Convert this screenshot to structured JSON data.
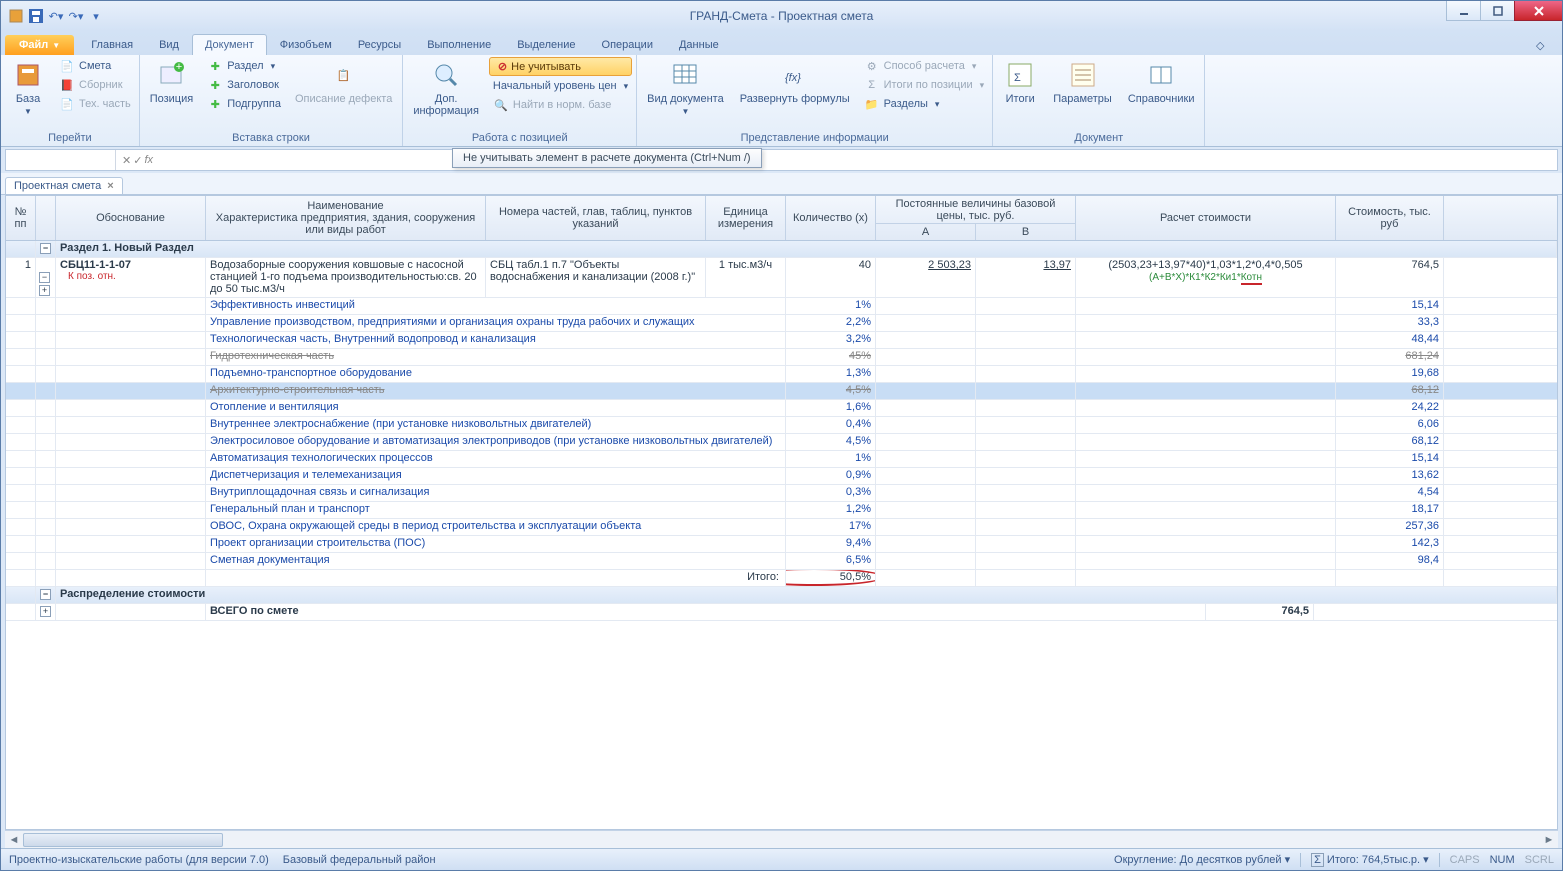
{
  "title": "ГРАНД-Смета - Проектная смета",
  "tabs": {
    "file": "Файл",
    "list": [
      "Главная",
      "Вид",
      "Документ",
      "Физобъем",
      "Ресурсы",
      "Выполнение",
      "Выделение",
      "Операции",
      "Данные"
    ],
    "active": "Документ"
  },
  "ribbon": {
    "group1": {
      "label": "Перейти",
      "base": "База",
      "smeta": "Смета",
      "sbornik": "Сборник",
      "techpart": "Тех. часть"
    },
    "group2": {
      "label": "Вставка строки",
      "position": "Позиция",
      "razdel": "Раздел",
      "zagolovok": "Заголовок",
      "podgruppa": "Подгруппа",
      "desc": "Описание дефекта"
    },
    "group3": {
      "label": "Работа с позицией",
      "dopinfo": "Доп.\nинформация",
      "neuch": "Не учитывать",
      "startlvl": "Начальный уровень цен",
      "findnorm": "Найти в норм. базе"
    },
    "group4": {
      "label": "Представление информации",
      "viddoc": "Вид документа",
      "razvern": "Развернуть формулы",
      "sposob": "Способ расчета",
      "itogipos": "Итоги по позиции",
      "razdely": "Разделы"
    },
    "group5": {
      "label": "Документ",
      "itogi": "Итоги",
      "params": "Параметры",
      "sprav": "Справочники"
    }
  },
  "tooltip": "Не учитывать элемент в расчете документа (Ctrl+Num /)",
  "doctab": "Проектная смета",
  "headers": {
    "num": "№ пп",
    "obos": "Обоснование",
    "naim": "Наименование\nХарактеристика предприятия, здания, сооружения или виды работ",
    "nomer": "Номера частей, глав, таблиц, пунктов указаний",
    "ed": "Единица измерения",
    "kol": "Количество (x)",
    "post": "Постоянные величины базовой цены, тыс. руб.",
    "a": "A",
    "b": "B",
    "ras": "Расчет стоимости",
    "stoim": "Стоимость, тыс. руб"
  },
  "section1": "Раздел 1. Новый Раздел",
  "row1": {
    "num": "1",
    "code": "СБЦ11-1-1-07",
    "kpoz": "К поз. отн.",
    "naim": "Водозаборные сооружения ковшовые с насосной станцией 1-го подъема производительностью:св. 20 до 50 тыс.м3/ч",
    "nomer": "СБЦ табл.1 п.7 \"Объекты водоснабжения и канализации (2008 г.)\"",
    "ed": "1 тыс.м3/ч",
    "kol": "40",
    "a": "2 503,23",
    "b": "13,97",
    "ras1": "(2503,23+13,97*40)*1,03*1,2*0,4*0,505",
    "ras2": "(А+В*X)*К1*К2*Ки1*Котн",
    "stoim": "764,5"
  },
  "subrows": [
    {
      "n": "Эффективность инвестиций",
      "p": "1%",
      "s": "15,14"
    },
    {
      "n": "Управление производством, предприятиями и организация охраны труда рабочих и служащих",
      "p": "2,2%",
      "s": "33,3"
    },
    {
      "n": "Технологическая часть, Внутренний водопровод и канализация",
      "p": "3,2%",
      "s": "48,44"
    },
    {
      "n": "Гидротехническая часть",
      "p": "45%",
      "s": "681,24",
      "struck": true
    },
    {
      "n": "Подъемно-транспортное оборудование",
      "p": "1,3%",
      "s": "19,68"
    },
    {
      "n": "Архитектурно-строительная часть",
      "p": "4,5%",
      "s": "68,12",
      "struck": true,
      "sel": true
    },
    {
      "n": "Отопление и вентиляция",
      "p": "1,6%",
      "s": "24,22"
    },
    {
      "n": "Внутреннее электроснабжение (при установке низковольтных двигателей)",
      "p": "0,4%",
      "s": "6,06"
    },
    {
      "n": "Электросиловое оборудование и автоматизация электроприводов (при установке низковольтных двигателей)",
      "p": "4,5%",
      "s": "68,12"
    },
    {
      "n": "Автоматизация технологических процессов",
      "p": "1%",
      "s": "15,14"
    },
    {
      "n": "Диспетчеризация и телемеханизация",
      "p": "0,9%",
      "s": "13,62"
    },
    {
      "n": "Внутриплощадочная связь и сигнализация",
      "p": "0,3%",
      "s": "4,54"
    },
    {
      "n": "Генеральный план и транспорт",
      "p": "1,2%",
      "s": "18,17"
    },
    {
      "n": "ОВОС, Охрана окружающей среды в период строительства и эксплуатации объекта",
      "p": "17%",
      "s": "257,36"
    },
    {
      "n": "Проект организации строительства (ПОС)",
      "p": "9,4%",
      "s": "142,3"
    },
    {
      "n": "Сметная документация",
      "p": "6,5%",
      "s": "98,4"
    }
  ],
  "itogo": {
    "label": "Итого:",
    "val": "50,5%"
  },
  "raspred": "Распределение стоимости",
  "vsego": {
    "label": "ВСЕГО по смете",
    "val": "764,5"
  },
  "status": {
    "left1": "Проектно-изыскательские работы (для версии 7.0)",
    "left2": "Базовый федеральный район",
    "okr": "Округление: До десятков рублей",
    "itogo": "Итого: 764,5тыс.р.",
    "caps": "CAPS",
    "num": "NUM",
    "scrl": "SCRL"
  }
}
